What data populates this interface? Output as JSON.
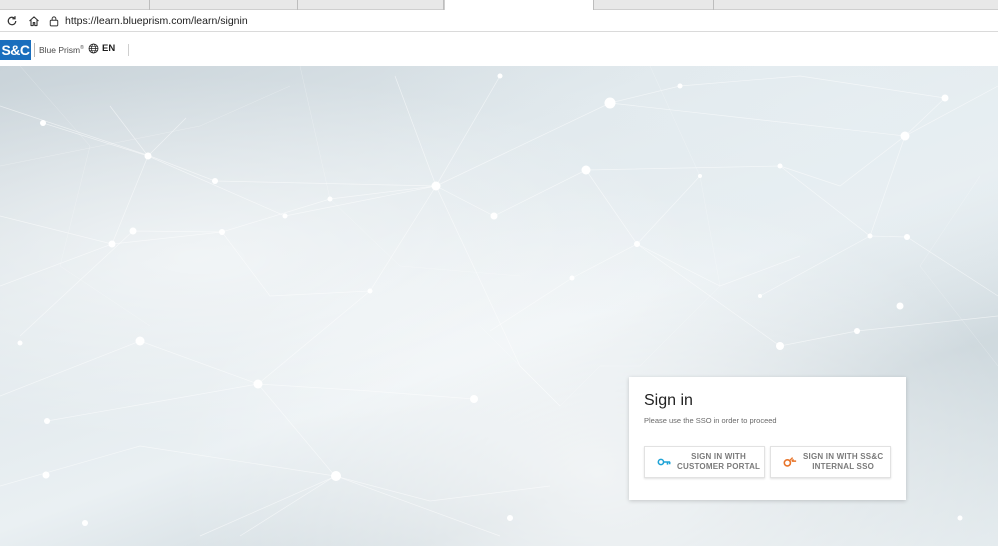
{
  "browser": {
    "url": "https://learn.blueprism.com/learn/signin",
    "icons": {
      "refresh": "refresh-icon",
      "home": "home-icon",
      "lock": "lock-icon"
    }
  },
  "header": {
    "logo_text": "S&C",
    "product_name": "Blue Prism",
    "product_mark": "®",
    "language": "EN",
    "brand_color": "#1a6ebd"
  },
  "signin": {
    "title": "Sign in",
    "subtitle": "Please use the SSO in order to proceed",
    "buttons": [
      {
        "line1": "SIGN IN WITH",
        "line2": "CUSTOMER PORTAL",
        "icon": "key-icon",
        "icon_color": "#1fa3d6"
      },
      {
        "line1": "SIGN IN WITH SS&C",
        "line2": "INTERNAL SSO",
        "icon": "sso-icon",
        "icon_color": "#e8742a"
      }
    ]
  }
}
